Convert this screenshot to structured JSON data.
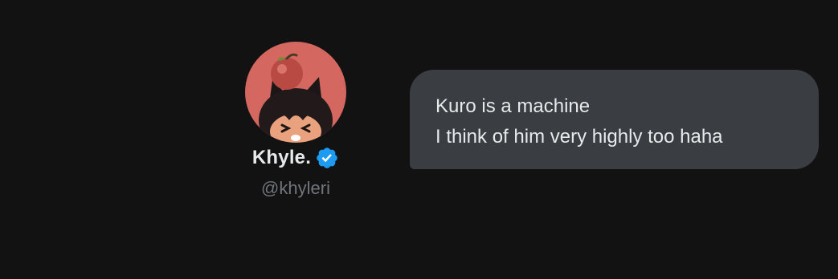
{
  "user": {
    "display_name": "Khyle.",
    "handle": "@khyleri",
    "verified": true,
    "avatar_icon": "avatar-cat-girl-with-apple"
  },
  "message": {
    "lines": [
      "Kuro is a machine",
      "I think of him very highly too haha"
    ]
  },
  "colors": {
    "background": "#121213",
    "bubble": "#3a3d41",
    "text": "#e7e9ea",
    "handle_text": "#71767b",
    "verified_badge": "#1d9bf0",
    "avatar_background": "#d4675f"
  }
}
